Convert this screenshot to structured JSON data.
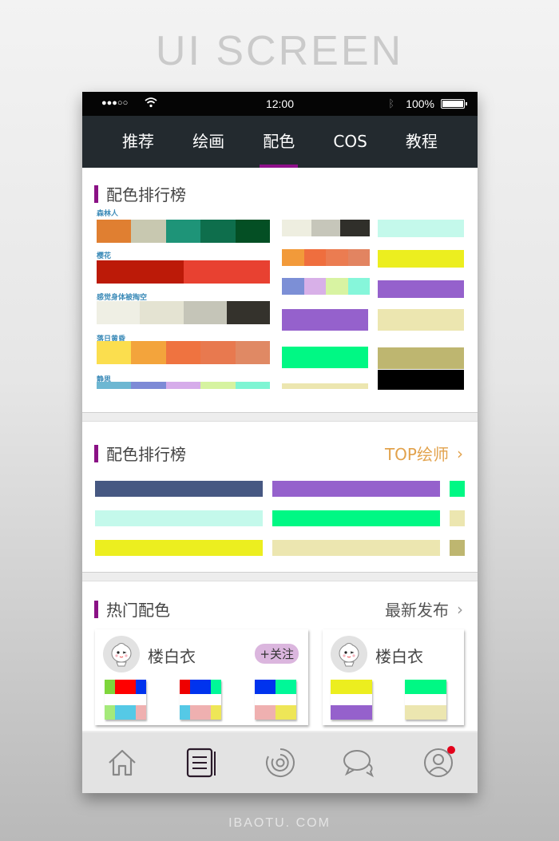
{
  "page_heading": "UI SCREEN",
  "footer_brand": "IBAOTU. COM",
  "status_bar": {
    "signal": "●●●○○",
    "time": "12:00",
    "battery": "100%"
  },
  "tabs": [
    {
      "label": "推荐",
      "active": false
    },
    {
      "label": "绘画",
      "active": false
    },
    {
      "label": "配色",
      "active": true
    },
    {
      "label": "COS",
      "active": false
    },
    {
      "label": "教程",
      "active": false
    }
  ],
  "section1": {
    "title": "配色排行榜",
    "palettes": [
      {
        "name": "森林人",
        "colors": [
          "#e07f31",
          "#c8c8b0",
          "#1e9478",
          "#0e6e4c",
          "#044f24"
        ]
      },
      {
        "name": "樱花",
        "colors": [
          "#bc1a08",
          "#e84131"
        ]
      },
      {
        "name": "感觉身体被掏空",
        "colors": [
          "#efefe4",
          "#e4e3d2",
          "#c5c5b8",
          "#34322c"
        ]
      },
      {
        "name": "落日黄昏",
        "colors": [
          "#fbde4e",
          "#f3a43c",
          "#ef7340",
          "#e8794f",
          "#e08964"
        ]
      },
      {
        "name": "静思",
        "colors": [
          "#6db7d2",
          "#7d8ad6",
          "#d6acea",
          "#d6f3a0",
          "#7ef5d3"
        ]
      }
    ],
    "column2": [
      [
        "#eeeee0",
        "#c6c6ba",
        "#302f2a"
      ],
      [
        "#f29a3a",
        "#ef6e3e",
        "#eb7c51",
        "#e28461"
      ],
      [
        "#7c8fd6",
        "#d8b0e8",
        "#d8f3a2",
        "#86f6da"
      ],
      [
        "#9561cc"
      ],
      [
        "#00f884"
      ],
      [
        "#ece6b0"
      ]
    ],
    "column3": [
      "#c4f9eb",
      "#ecee1f",
      "#9561cc",
      "#ece6b0",
      "#beb670",
      "#000000"
    ]
  },
  "section2": {
    "title": "配色排行榜",
    "link": "TOP绘师",
    "rows": [
      [
        "#465882",
        "#9561cc",
        "#00f884"
      ],
      [
        "#c4f9eb",
        "#00f884",
        "#ece6b0"
      ],
      [
        "#ecee1f",
        "#ece6b0",
        "#beb670"
      ]
    ]
  },
  "section3": {
    "title": "热门配色",
    "link": "最新发布",
    "cards": [
      {
        "name": "楼白衣",
        "follow_label": "+关注",
        "palettes": [
          {
            "top": [
              "#7ed63b",
              "#ff0000",
              "#ff0000",
              "#0033ee"
            ],
            "bottom": [
              "#a5ea7a",
              "#55c9e6",
              "#55c9e6",
              "#efb0b0"
            ]
          },
          {
            "top": [
              "#ee0000",
              "#0033ee",
              "#0033ee",
              "#00f898"
            ],
            "bottom": [
              "#55c9e6",
              "#efb0b0",
              "#efb0b0",
              "#eee657"
            ]
          },
          {
            "top": [
              "#0033ee",
              "#0033ee",
              "#00f898",
              "#00f898"
            ],
            "bottom": [
              "#efb0b0",
              "#efb0b0",
              "#eee657",
              "#eee657"
            ]
          }
        ]
      },
      {
        "name": "楼白衣",
        "palettes": [
          {
            "top": [
              "#ecee1f"
            ],
            "bottom": [
              "#9561cc"
            ]
          },
          {
            "top": [
              "#00f884"
            ],
            "bottom": [
              "#ece6b0"
            ]
          }
        ]
      }
    ]
  },
  "bottom_nav": [
    {
      "icon": "home-icon",
      "active": false
    },
    {
      "icon": "news-icon",
      "active": true
    },
    {
      "icon": "discover-icon",
      "active": false
    },
    {
      "icon": "chat-icon",
      "active": false
    },
    {
      "icon": "profile-icon",
      "active": false,
      "badge": true
    }
  ],
  "colors": {
    "accent": "#8a1185",
    "tab_bg": "#232a2f",
    "link_orange": "#e2a24c",
    "badge_red": "#e3001b"
  }
}
